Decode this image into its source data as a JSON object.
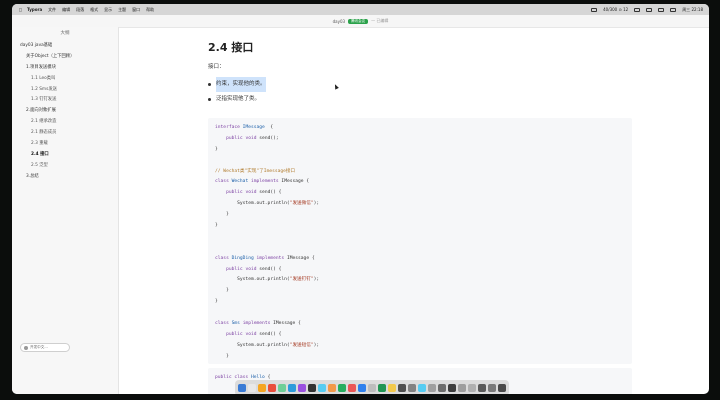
{
  "menubar": {
    "app_name": "Typora",
    "menus": [
      "文件",
      "编辑",
      "段落",
      "格式",
      "显示",
      "主题",
      "窗口",
      "帮助"
    ],
    "status_text": "40/300 ⊙ 12",
    "clock": "周三 22:18"
  },
  "titlebar": {
    "doc_name": "day03",
    "meeting_badge": "腾讯会议",
    "edited": "— 已编辑"
  },
  "sidebar": {
    "title": "大纲",
    "toc": [
      {
        "label": "day03 java基础",
        "level": 1
      },
      {
        "label": "关于Object（上下回顾）",
        "level": 2
      },
      {
        "label": "1.项目发送模块",
        "level": 2
      },
      {
        "label": "1.1 Leo类叫",
        "level": 3
      },
      {
        "label": "1.2 Sms发送",
        "level": 3
      },
      {
        "label": "1.3 钉钉发送",
        "level": 3
      },
      {
        "label": "2.面向对象扩展",
        "level": 2
      },
      {
        "label": "2.1 继承改造",
        "level": 3
      },
      {
        "label": "2.1 静态成员",
        "level": 3
      },
      {
        "label": "2.3 重载",
        "level": 3
      },
      {
        "label": "2.4 接口",
        "level": 3,
        "active": true
      },
      {
        "label": "2.5 泛型",
        "level": 3
      },
      {
        "label": "3.总结",
        "level": 2
      }
    ],
    "button_label": "开发中文..."
  },
  "doc": {
    "heading": "2.4 接口",
    "intro": "接口：",
    "bullets": [
      "约束，实现他的类。",
      "泛指实现他了类。"
    ]
  },
  "code_blocks": [
    {
      "lines": [
        [
          [
            "kw",
            "interface "
          ],
          [
            "cn",
            "IMessage"
          ],
          [
            "",
            "  {"
          ]
        ],
        [
          [
            "",
            "    "
          ],
          [
            "kw",
            "public void "
          ],
          [
            "",
            "send();"
          ]
        ],
        [
          [
            "",
            "}"
          ]
        ],
        [
          [
            "",
            ""
          ]
        ],
        [
          [
            "cm",
            "// Wechat类\"实现\"了Imessage接口"
          ]
        ],
        [
          [
            "kw",
            "class "
          ],
          [
            "cn",
            "Wechat "
          ],
          [
            "kw",
            "implements "
          ],
          [
            "",
            "IMessage {"
          ]
        ],
        [
          [
            "",
            "    "
          ],
          [
            "kw",
            "public void "
          ],
          [
            "",
            "send() {"
          ]
        ],
        [
          [
            "",
            "        System.out.println("
          ],
          [
            "st",
            "\"发送微信\""
          ],
          [
            "",
            ");"
          ]
        ],
        [
          [
            "",
            "    }"
          ]
        ],
        [
          [
            "",
            "}"
          ]
        ],
        [
          [
            "",
            ""
          ]
        ],
        [
          [
            "",
            ""
          ]
        ],
        [
          [
            "kw",
            "class "
          ],
          [
            "cn",
            "DingDing "
          ],
          [
            "kw",
            "implements "
          ],
          [
            "",
            "IMessage {"
          ]
        ],
        [
          [
            "",
            "    "
          ],
          [
            "kw",
            "public void "
          ],
          [
            "",
            "send() {"
          ]
        ],
        [
          [
            "",
            "        System.out.println("
          ],
          [
            "st",
            "\"发送钉钉\""
          ],
          [
            "",
            ");"
          ]
        ],
        [
          [
            "",
            "    }"
          ]
        ],
        [
          [
            "",
            "}"
          ]
        ],
        [
          [
            "",
            ""
          ]
        ],
        [
          [
            "kw",
            "class "
          ],
          [
            "cn",
            "Sms "
          ],
          [
            "kw",
            "implements "
          ],
          [
            "",
            "IMessage {"
          ]
        ],
        [
          [
            "",
            "    "
          ],
          [
            "kw",
            "public void "
          ],
          [
            "",
            "send() {"
          ]
        ],
        [
          [
            "",
            "        System.out.println("
          ],
          [
            "st",
            "\"发送短信\""
          ],
          [
            "",
            ");"
          ]
        ],
        [
          [
            "",
            "    }"
          ]
        ],
        [
          [
            "",
            "}"
          ]
        ]
      ]
    },
    {
      "lines": [
        [
          [
            "kw",
            "public class "
          ],
          [
            "cn",
            "Hello "
          ],
          [
            "",
            "{"
          ]
        ]
      ]
    }
  ],
  "colors": {
    "dock_icons": [
      "#3a7bd5",
      "#e8e8e8",
      "#f5a623",
      "#e94e3c",
      "#6fcf97",
      "#2d9cdb",
      "#9b51e0",
      "#333333",
      "#56ccf2",
      "#f2994a",
      "#27ae60",
      "#eb5757",
      "#2f80ed",
      "#bdbdbd",
      "#219653",
      "#f2c94c",
      "#4f4f4f",
      "#828282",
      "#56ccf2",
      "#a0a0a0",
      "#6c6c6c",
      "#3d3d3d",
      "#9e9e9e",
      "#b0b0b0",
      "#5a5a5a",
      "#7a7a7a",
      "#4a4a4a"
    ]
  }
}
